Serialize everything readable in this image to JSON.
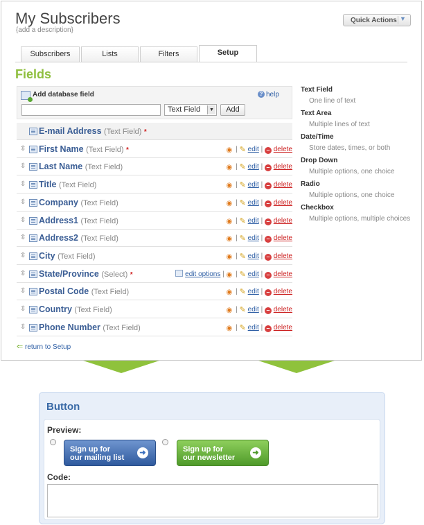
{
  "header": {
    "title": "My Subscribers",
    "description": "{add a description}",
    "quick_actions_label": "Quick Actions",
    "quick_actions_arrow": "▼"
  },
  "tabs": [
    {
      "label": "Subscribers",
      "active": false
    },
    {
      "label": "Lists",
      "active": false
    },
    {
      "label": "Filters",
      "active": false
    },
    {
      "label": "Setup",
      "active": true
    }
  ],
  "fields_heading": "Fields",
  "add_field": {
    "label": "Add database field",
    "help": "help",
    "input_value": "",
    "type_selected": "Text Field",
    "add_button": "Add"
  },
  "fields": [
    {
      "name": "E-mail Address",
      "type": "(Text Field)",
      "required": true,
      "actions": false
    },
    {
      "name": "First Name",
      "type": "(Text Field)",
      "required": true,
      "actions": true
    },
    {
      "name": "Last Name",
      "type": "(Text Field)",
      "required": false,
      "actions": true
    },
    {
      "name": "Title",
      "type": "(Text Field)",
      "required": false,
      "actions": true
    },
    {
      "name": "Company",
      "type": "(Text Field)",
      "required": false,
      "actions": true
    },
    {
      "name": "Address1",
      "type": "(Text Field)",
      "required": false,
      "actions": true
    },
    {
      "name": "Address2",
      "type": "(Text Field)",
      "required": false,
      "actions": true
    },
    {
      "name": "City",
      "type": "(Text Field)",
      "required": false,
      "actions": true
    },
    {
      "name": "State/Province",
      "type": "(Select)",
      "required": true,
      "actions": true,
      "edit_options": "edit options"
    },
    {
      "name": "Postal Code",
      "type": "(Text Field)",
      "required": false,
      "actions": true
    },
    {
      "name": "Country",
      "type": "(Text Field)",
      "required": false,
      "actions": true
    },
    {
      "name": "Phone Number",
      "type": "(Text Field)",
      "required": false,
      "actions": true
    }
  ],
  "actions": {
    "edit": "edit",
    "delete": "delete",
    "required_mark": "*",
    "separator": "|"
  },
  "return_link": "return to Setup",
  "legend": [
    {
      "title": "Text Field",
      "desc": "One line of text"
    },
    {
      "title": "Text Area",
      "desc": "Multiple lines of text"
    },
    {
      "title": "Date/Time",
      "desc": "Store dates, times, or both"
    },
    {
      "title": "Drop Down",
      "desc": "Multiple options, one choice"
    },
    {
      "title": "Radio",
      "desc": "Multiple options, one choice"
    },
    {
      "title": "Checkbox",
      "desc": "Multiple options, multiple choices"
    }
  ],
  "button_panel": {
    "heading": "Button",
    "preview_label": "Preview:",
    "button1_line1": "Sign up for",
    "button1_line2": "our mailing list",
    "button2_line1": "Sign up for",
    "button2_line2": "our newsletter",
    "code_label": "Code:",
    "code_value": ""
  },
  "colors": {
    "accent_green": "#8fc23c",
    "link_blue": "#2f5fa5",
    "field_name": "#3b5e95",
    "delete_red": "#cc2020",
    "button_blue": "#2f5a9e",
    "button_green": "#4f9a2a"
  },
  "icons": {
    "drag": "drag-handle-icon",
    "field": "field-icon",
    "rss": "rss-icon",
    "pencil": "pencil-icon",
    "delete": "delete-icon",
    "arrow": "arrow-right-icon"
  }
}
